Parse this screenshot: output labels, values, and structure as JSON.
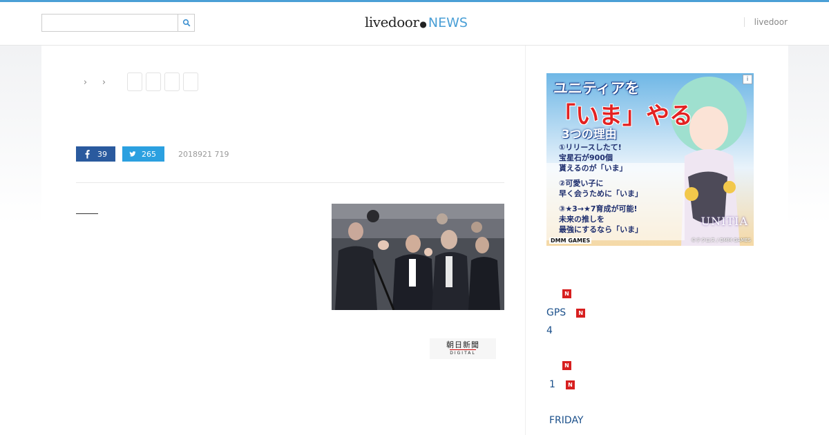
{
  "colors": {
    "accent_top_line": "#4a9fd6",
    "facebook": "#2a5a9e",
    "twitter": "#2ba0e0",
    "news_badge": "#d71f1f",
    "link": "#1a4f8a"
  },
  "header": {
    "search": {
      "placeholder": "",
      "value": "",
      "icon": "search-icon"
    },
    "logo": {
      "main": "livedoor",
      "news": "NEWS"
    },
    "right_link": "livedoor"
  },
  "article": {
    "breadcrumb_separators": [
      "›",
      "›"
    ],
    "social": {
      "facebook_count": "39",
      "twitter_count": "265"
    },
    "date": "2018921 719",
    "source_logo": {
      "jp": "朝日新聞",
      "en": "DIGITAL"
    }
  },
  "sidebar": {
    "ad": {
      "title1": "ユニティアを",
      "title2": "「いま」やる",
      "title3": "3つの理由",
      "points": [
        "①リリースしたて!",
        "宝星石が900個",
        "貰えるのが「いま」",
        "②可愛い子に",
        "早く会うために「いま」",
        "③★3→★7育成が可能!",
        "未来の推しを",
        "最強にするなら「いま」"
      ],
      "brand": "DMM GAMES",
      "game_name": "UNITIA",
      "copyright": "©テクロス / DMM GAMES",
      "info_icon": "i"
    },
    "news": [
      {
        "text": "",
        "badge": "N"
      },
      {
        "text": "GPS",
        "badge": "N"
      },
      {
        "text": "4",
        "badge": ""
      },
      {
        "text": "",
        "badge": "N"
      },
      {
        "text": "1",
        "badge": "N"
      },
      {
        "text": "FRIDAY",
        "badge": ""
      }
    ]
  }
}
